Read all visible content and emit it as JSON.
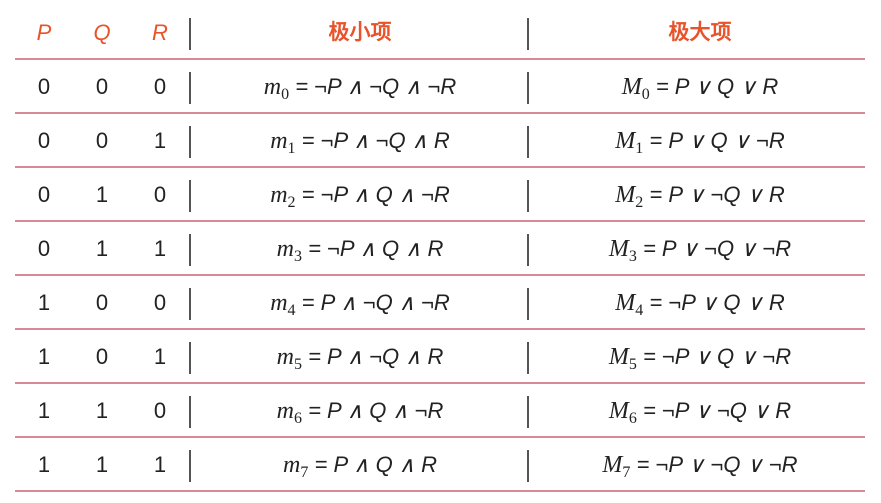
{
  "header": {
    "p": "P",
    "q": "Q",
    "r": "R",
    "minterm_title": "极小项",
    "maxterm_title": "极大项"
  },
  "colors": {
    "header_text": "#e8532a",
    "rule_line": "#d98a96"
  },
  "rows": [
    {
      "p": "0",
      "q": "0",
      "r": "0",
      "min_name": "m",
      "min_sub": "0",
      "min_rhs": " = ¬P ∧ ¬Q ∧ ¬R",
      "max_name": "M",
      "max_sub": "0",
      "max_rhs": " = P ∨ Q ∨ R"
    },
    {
      "p": "0",
      "q": "0",
      "r": "1",
      "min_name": "m",
      "min_sub": "1",
      "min_rhs": " = ¬P ∧ ¬Q ∧ R",
      "max_name": "M",
      "max_sub": "1",
      "max_rhs": " = P ∨ Q ∨ ¬R"
    },
    {
      "p": "0",
      "q": "1",
      "r": "0",
      "min_name": "m",
      "min_sub": "2",
      "min_rhs": " = ¬P ∧ Q ∧ ¬R",
      "max_name": "M",
      "max_sub": "2",
      "max_rhs": " = P ∨ ¬Q ∨ R"
    },
    {
      "p": "0",
      "q": "1",
      "r": "1",
      "min_name": "m",
      "min_sub": "3",
      "min_rhs": " = ¬P ∧ Q ∧ R",
      "max_name": "M",
      "max_sub": "3",
      "max_rhs": " = P ∨ ¬Q ∨ ¬R"
    },
    {
      "p": "1",
      "q": "0",
      "r": "0",
      "min_name": "m",
      "min_sub": "4",
      "min_rhs": " = P ∧ ¬Q ∧ ¬R",
      "max_name": "M",
      "max_sub": "4",
      "max_rhs": " = ¬P ∨ Q ∨ R"
    },
    {
      "p": "1",
      "q": "0",
      "r": "1",
      "min_name": "m",
      "min_sub": "5",
      "min_rhs": " = P ∧ ¬Q ∧ R",
      "max_name": "M",
      "max_sub": "5",
      "max_rhs": " = ¬P ∨ Q ∨ ¬R"
    },
    {
      "p": "1",
      "q": "1",
      "r": "0",
      "min_name": "m",
      "min_sub": "6",
      "min_rhs": " = P ∧ Q ∧ ¬R",
      "max_name": "M",
      "max_sub": "6",
      "max_rhs": " = ¬P ∨ ¬Q ∨ R"
    },
    {
      "p": "1",
      "q": "1",
      "r": "1",
      "min_name": "m",
      "min_sub": "7",
      "min_rhs": " = P ∧ Q ∧ R",
      "max_name": "M",
      "max_sub": "7",
      "max_rhs": " = ¬P ∨ ¬Q ∨ ¬R"
    }
  ]
}
